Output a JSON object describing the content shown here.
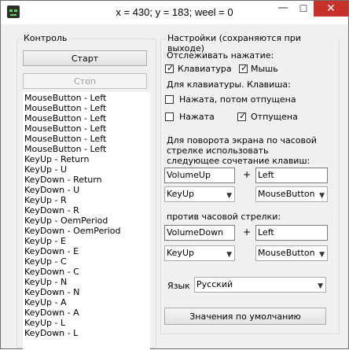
{
  "window": {
    "title": "x = 430; y = 183; weel = 0",
    "minimize_glyph": "—",
    "maximize_glyph": "☐",
    "close_glyph": "✕"
  },
  "control": {
    "group_title": "Контроль",
    "start_label": "Старт",
    "stop_label": "Стоп",
    "log_items": [
      "MouseButton - Left",
      "MouseButton - Left",
      "MouseButton - Left",
      "MouseButton - Left",
      "MouseButton - Left",
      "MouseButton - Left",
      "KeyUp - Return",
      "KeyUp - U",
      "KeyDown - Return",
      "KeyDown - U",
      "KeyUp - R",
      "KeyDown - R",
      "KeyUp - OemPeriod",
      "KeyDown - OemPeriod",
      "KeyUp - E",
      "KeyDown - E",
      "KeyUp - C",
      "KeyDown - C",
      "KeyUp - N",
      "KeyDown - N",
      "KeyUp - A",
      "KeyDown - A",
      "KeyUp - L",
      "KeyDown - L"
    ]
  },
  "settings": {
    "group_title": "Настройки (сохраняются при выходе)",
    "track_label": "Отслеживать нажатие:",
    "keyboard_label": "Клавиатура",
    "keyboard_checked": true,
    "mouse_label": "Мышь",
    "mouse_checked": true,
    "keyboard_section_label": "Для клавиатуры. Клавиша:",
    "pressed_then_released_label": "Нажата, потом отпущена",
    "pressed_then_released_checked": false,
    "pressed_label": "Нажата",
    "pressed_checked": false,
    "released_label": "Отпущена",
    "released_checked": true,
    "clockwise_label_line1": "Для поворота экрана по часовой",
    "clockwise_label_line2": "стрелке использовать",
    "clockwise_label_line3": "следующее сочетание клавиш:",
    "clockwise_key1": "VolumeUp",
    "clockwise_key2": "Left",
    "clockwise_event1": "KeyUp",
    "clockwise_event2": "MouseButton",
    "counter_label": "против часовой стрелки:",
    "counter_key1": "VolumeDown",
    "counter_key2": "Left",
    "counter_event1": "KeyUp",
    "counter_event2": "MouseButton",
    "plus": "+",
    "language_label": "Язык",
    "language_value": "Русский",
    "defaults_button_label": "Значения по умолчанию",
    "check_glyph": "✓",
    "dropdown_glyph": "▼"
  },
  "colors": {
    "close_button": "#c7312a",
    "window_bg": "#f0f0f0"
  },
  "icons": {
    "app": "app-face-icon",
    "dropdown": "chevron-down-icon",
    "check": "checkmark-icon"
  }
}
